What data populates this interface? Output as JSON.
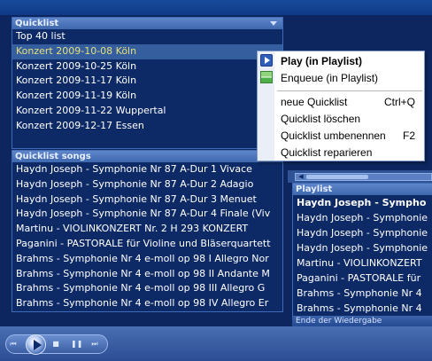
{
  "quicklist": {
    "header": "Quicklist",
    "items": [
      "Top 40 list",
      "Konzert 2009-10-08 Köln",
      "Konzert 2009-10-25 Köln",
      "Konzert 2009-11-17 Köln",
      "Konzert 2009-11-19 Köln",
      "Konzert 2009-11-22 Wuppertal",
      "Konzert 2009-12-17 Essen"
    ],
    "selected_index": 1
  },
  "songs": {
    "header": "Quicklist songs",
    "items": [
      "Haydn Joseph - Symphonie Nr 87 A-Dur 1 Vivace",
      "Haydn Joseph - Symphonie Nr 87 A-Dur 2 Adagio",
      "Haydn Joseph - Symphonie Nr 87 A-Dur 3 Menuet",
      "Haydn Joseph - Symphonie Nr 87 A-Dur 4 Finale (Viv",
      "Martinu - VIOLINKONZERT  Nr. 2  H 293     KONZERT",
      "Paganini - PASTORALE für Violine und Bläserquartett",
      "Brahms - Symphonie Nr 4 e-moll op 98 I Allegro Nor",
      "Brahms - Symphonie Nr 4 e-moll op 98 II Andante M",
      "Brahms - Symphonie Nr 4 e-moll op 98 III Allegro G",
      "Brahms - Symphonie Nr 4 e-moll op 98 IV Allegro Er"
    ]
  },
  "playlist": {
    "header": "Playlist",
    "items": [
      "Haydn Joseph - Sympho",
      "Haydn Joseph - Symphonie",
      "Haydn Joseph - Symphonie",
      "Haydn Joseph - Symphonie",
      "Martinu - VIOLINKONZERT",
      "Paganini - PASTORALE für",
      "Brahms - Symphonie Nr 4",
      "Brahms - Symphonie Nr 4"
    ],
    "current_index": 0,
    "status": "Ende der Wiedergabe"
  },
  "context_menu": {
    "play": "Play (in Playlist)",
    "enqueue": "Enqueue (in Playlist)",
    "new": "neue Quicklist",
    "new_shortcut": "Ctrl+Q",
    "delete": "Quicklist löschen",
    "rename": "Quicklist umbenennen",
    "rename_shortcut": "F2",
    "repair": "Quicklist reparieren"
  },
  "icons": {
    "play": "play-icon",
    "enqueue": "enqueue-icon",
    "prev": "previous-icon",
    "stop": "stop-icon",
    "next": "next-icon",
    "chevron": "chevron-down-icon"
  },
  "colors": {
    "background": "#0d2660",
    "header": "#4a73b9",
    "selected": "#345e9e",
    "selected_text": "#e8df7a"
  }
}
